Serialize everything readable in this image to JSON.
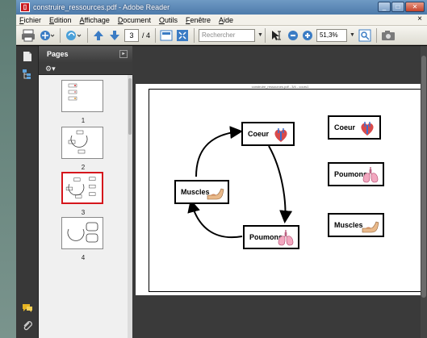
{
  "window": {
    "title": "construire_ressources.pdf - Adobe Reader",
    "app_icon": "pdf-icon",
    "controls": [
      "minimize-icon",
      "restore-icon",
      "close-icon"
    ]
  },
  "menu": {
    "items": [
      "Fichier",
      "Edition",
      "Affichage",
      "Document",
      "Outils",
      "Fenêtre",
      "Aide"
    ],
    "close_doc": "×"
  },
  "toolbar": {
    "page_current": "3",
    "page_total": "/ 4",
    "search_placeholder": "Rechercher",
    "zoom": "51,3%",
    "icons": [
      "print-icon",
      "email-icon",
      "collaborate-icon",
      "prev-page-icon",
      "next-page-icon",
      "fit-width-icon",
      "fit-page-icon",
      "select-tool-icon",
      "zoom-out-icon",
      "zoom-in-icon",
      "zoom-marquee-icon",
      "snapshot-icon"
    ]
  },
  "pages_panel": {
    "title": "Pages",
    "thumbnails": [
      {
        "label": "1",
        "selected": false
      },
      {
        "label": "2",
        "selected": false
      },
      {
        "label": "3",
        "selected": true
      },
      {
        "label": "4",
        "selected": false
      }
    ]
  },
  "document": {
    "page_header": "construire_ressources.pdf - 3/4 - cours1",
    "cycle_cards": [
      {
        "label": "Coeur",
        "icon": "heart-icon"
      },
      {
        "label": "Poumons",
        "icon": "lungs-icon"
      },
      {
        "label": "Muscles",
        "icon": "arm-muscle-icon"
      }
    ],
    "legend_cards": [
      {
        "label": "Coeur",
        "icon": "heart-icon"
      },
      {
        "label": "Poumons",
        "icon": "lungs-icon"
      },
      {
        "label": "Muscles",
        "icon": "arm-muscle-icon"
      }
    ]
  },
  "colors": {
    "title_bar": "#4e7bab",
    "selection": "#d5161c",
    "background": "#3a3a3a"
  }
}
